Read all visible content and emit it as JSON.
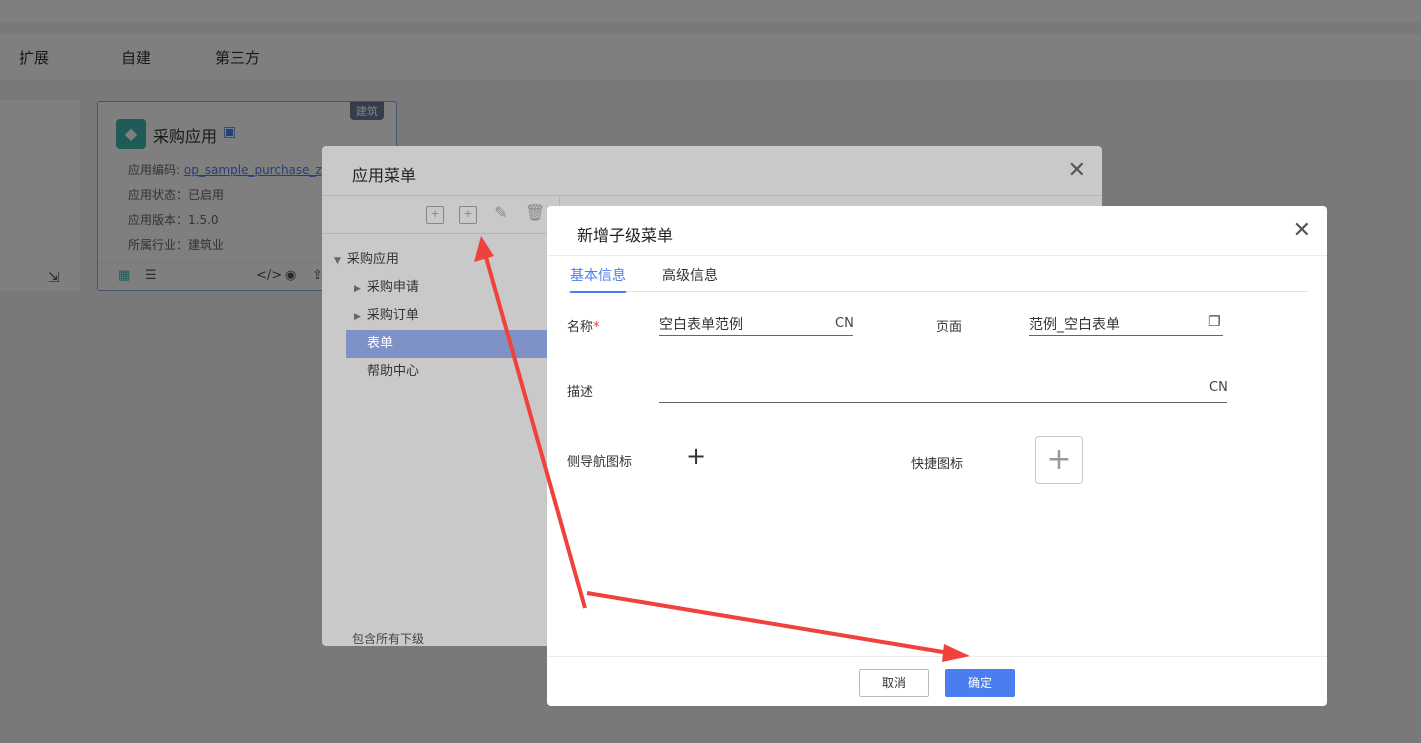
{
  "background": {
    "breadcrumb": "",
    "tabs": [
      "扩展",
      "自建",
      "第三方"
    ],
    "card": {
      "badge": "建筑",
      "name": "采购应用",
      "code_label": "应用编码:",
      "code_value": "op_sample_purchase_zy",
      "status": "应用状态：已启用",
      "version": "应用版本：1.5.0",
      "industry": "所属行业：建筑业"
    }
  },
  "menu_dialog": {
    "title": "应用菜单",
    "tree": {
      "root": "采购应用",
      "items": [
        "采购申请",
        "采购订单",
        "表单",
        "帮助中心"
      ]
    },
    "include_children_label": "包含所有下级"
  },
  "child_dialog": {
    "title": "新增子级菜单",
    "tabs": [
      "基本信息",
      "高级信息"
    ],
    "name_label": "名称",
    "required_mark": "*",
    "name_value": "空白表单范例",
    "lang_suffix": "CN",
    "page_label": "页面",
    "page_value": "范例_空白表单",
    "desc_label": "描述",
    "desc_value": "",
    "desc_suffix": "CN",
    "side_nav_icon_label": "侧导航图标",
    "quick_icon_label": "快捷图标",
    "cancel_label": "取消",
    "confirm_label": "确定"
  },
  "colors": {
    "accent": "#4a7ef0",
    "annotation": "#f0413c"
  }
}
